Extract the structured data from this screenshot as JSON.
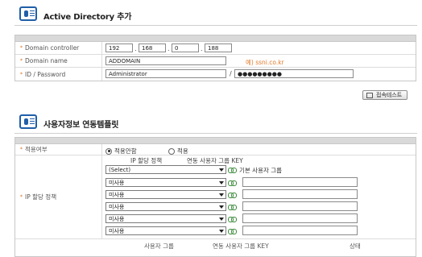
{
  "section1": {
    "title": "Active Directory 추가"
  },
  "ad_form": {
    "domain_controller": {
      "label": "Domain controller",
      "ip": [
        "192",
        "168",
        "0",
        "188"
      ],
      "dot": "."
    },
    "domain_name": {
      "label": "Domain name",
      "value": "ADDOMAIN",
      "hint": "예) ssni.co.kr"
    },
    "id_password": {
      "label": "ID / Password",
      "id_value": "Administrator",
      "slash": "/",
      "password_value": "●●●●●●●●●"
    },
    "test_button": "접속테스트"
  },
  "section2": {
    "title": "사용자정보 연동템플릿"
  },
  "template_form": {
    "apply": {
      "label": "적용여부",
      "options": [
        {
          "label": "적용안함",
          "selected": true
        },
        {
          "label": "적용",
          "selected": false
        }
      ]
    },
    "ip_policy": {
      "label": "IP 할당 정책",
      "col_headers": [
        "IP 할당 정책",
        "연동 사용자 그룹 KEY"
      ],
      "rows": [
        {
          "select": "(Select)",
          "group_text": "기본 사용자 그룹"
        },
        {
          "select": "미사용",
          "group_value": ""
        },
        {
          "select": "미사용",
          "group_value": ""
        },
        {
          "select": "미사용",
          "group_value": ""
        },
        {
          "select": "미사용",
          "group_value": ""
        },
        {
          "select": "미사용",
          "group_value": ""
        }
      ]
    },
    "bottom_headers": [
      "사용자 그룹",
      "연동 사용자 그룹 KEY",
      "상태"
    ]
  },
  "colors": {
    "accent_orange": "#e07a2a",
    "icon_blue": "#1f5fa8",
    "link_green": "#3b8a3b"
  },
  "icons": [
    "directory-icon",
    "test-icon",
    "link-icon",
    "dropdown-arrow-icon"
  ]
}
